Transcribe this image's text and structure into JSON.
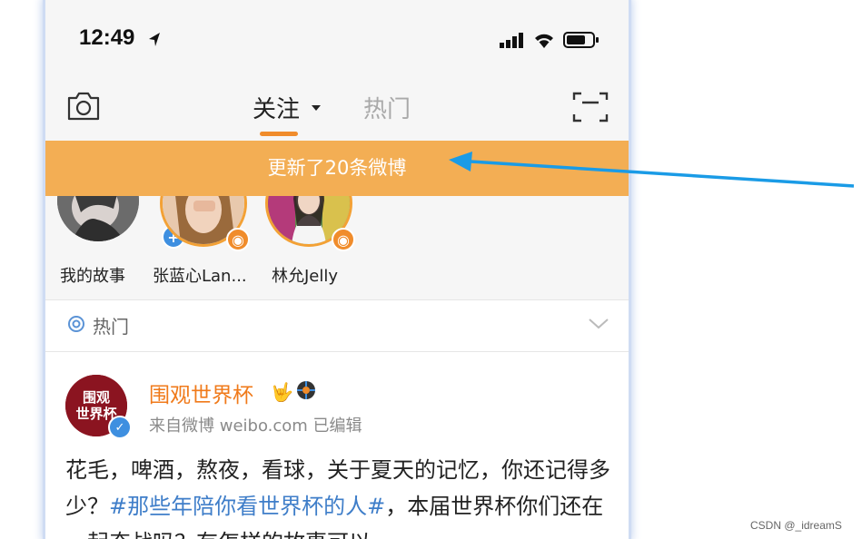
{
  "status_bar": {
    "time": "12:49"
  },
  "header": {
    "tabs": [
      {
        "label": "关注",
        "active": true
      },
      {
        "label": "热门",
        "active": false
      }
    ]
  },
  "banner": {
    "text": "更新了20条微博",
    "color": "#f3ae54"
  },
  "stories": [
    {
      "label": "我的故事"
    },
    {
      "label": "张蓝心Lan..."
    },
    {
      "label": "林允Jelly"
    }
  ],
  "hot_section": {
    "label": "热门"
  },
  "post": {
    "author": "围观世界杯",
    "avatar_text_top": "围观",
    "avatar_text_bottom": "世界杯",
    "meta": "来自微博 weibo.com  已编辑",
    "text_before": "花毛，啤酒，熬夜，看球，关于夏天的记忆，你还记得多少？",
    "hashtag": "#那些年陪你看世界杯的人#",
    "text_after": "，本届世界杯你们还在一起奋战吗？有怎样的故事可以"
  },
  "watermark": "CSDN @_idreamS",
  "colors": {
    "accent_orange": "#f08c2b",
    "link_blue": "#3f7ec9",
    "arrow_blue": "#1a9be6"
  }
}
